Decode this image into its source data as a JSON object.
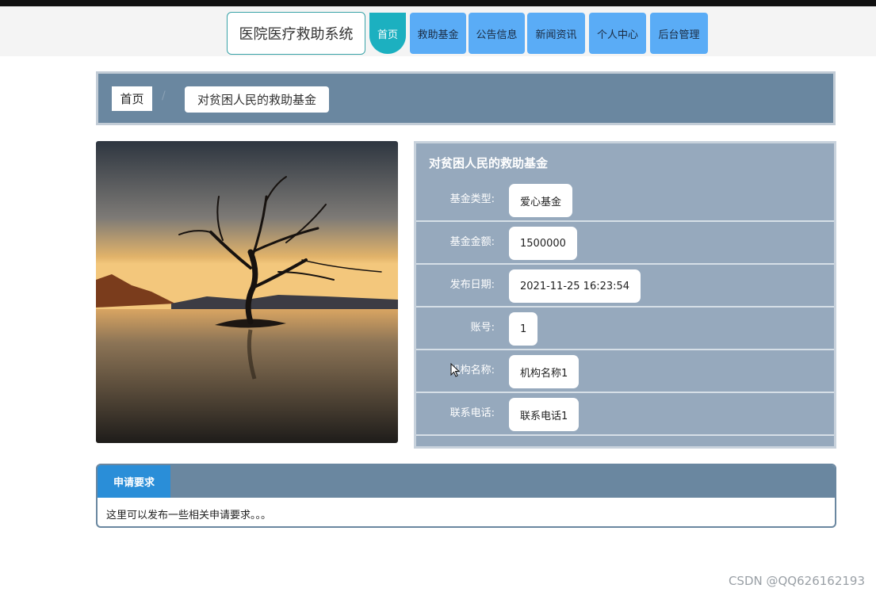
{
  "brand": "医院医疗救助系统",
  "nav": [
    {
      "label": "首页",
      "active": true
    },
    {
      "label": "救助基金",
      "active": false
    },
    {
      "label": "公告信息",
      "active": false
    },
    {
      "label": "新闻资讯",
      "active": false
    },
    {
      "label": "个人中心",
      "active": false
    },
    {
      "label": "后台管理",
      "active": false
    }
  ],
  "breadcrumb": {
    "home": "首页",
    "separator": "/",
    "current": "对贫困人民的救助基金"
  },
  "detail": {
    "title": "对贫困人民的救助基金",
    "rows": [
      {
        "label": "基金类型:",
        "value": "爱心基金"
      },
      {
        "label": "基金金额:",
        "value": "1500000"
      },
      {
        "label": "发布日期:",
        "value": "2021-11-25 16:23:54"
      },
      {
        "label": "账号:",
        "value": "1"
      },
      {
        "label": "机构名称:",
        "value": "机构名称1"
      },
      {
        "label": "联系电话:",
        "value": "联系电话1"
      }
    ]
  },
  "requirements": {
    "tab": "申请要求",
    "text": "这里可以发布一些相关申请要求。。。"
  },
  "watermark": "CSDN @QQ626162193",
  "colors": {
    "nav": "#5aacf6",
    "nav_active": "#1cb0c0",
    "panel": "#6a87a0",
    "detail_bg": "#96a9bd",
    "tab": "#2a8ed8"
  }
}
